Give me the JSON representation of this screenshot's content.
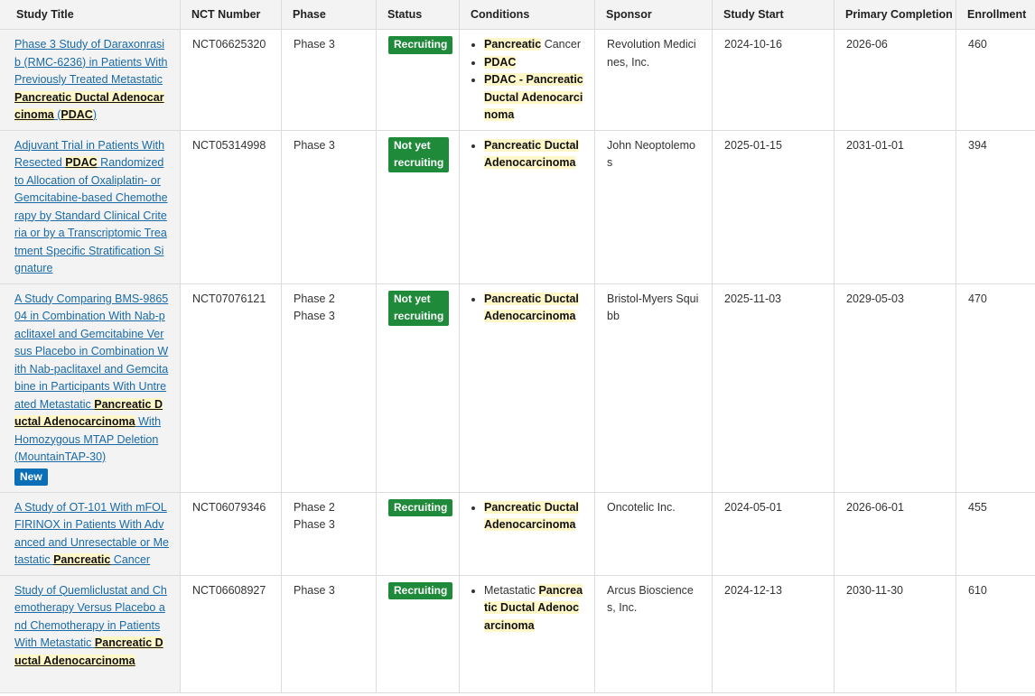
{
  "headers": {
    "title": "Study Title",
    "nct": "NCT Number",
    "phase": "Phase",
    "status": "Status",
    "conditions": "Conditions",
    "sponsor": "Sponsor",
    "start": "Study Start",
    "completion": "Primary Completion",
    "enrollment": "Enrollment"
  },
  "rows": [
    {
      "title": [
        {
          "t": "Phase 3 Study of Daraxonrasib (RMC-6236) in Patients With Previously Treated Metastatic "
        },
        {
          "t": "Pancreatic Ductal Adenocarcinoma",
          "hl": true
        },
        {
          "t": " ("
        },
        {
          "t": "PDAC",
          "hl": true
        },
        {
          "t": ")"
        }
      ],
      "new": "",
      "nct": "NCT06625320",
      "phases": [
        "Phase 3"
      ],
      "status": "Recruiting",
      "status_lines": [
        "Recruiting"
      ],
      "conditions": [
        [
          {
            "t": "Pancreatic",
            "hl": true
          },
          {
            "t": " Cancer"
          }
        ],
        [
          {
            "t": "PDAC",
            "hl": true
          }
        ],
        [
          {
            "t": "PDAC - Pancreatic Ductal Adenocarcinoma",
            "hl": true
          }
        ]
      ],
      "sponsor": "Revolution Medicines, Inc.",
      "start": "2024-10-16",
      "completion": "2026-06",
      "enrollment": "460"
    },
    {
      "title": [
        {
          "t": "Adjuvant Trial in Patients With Resected "
        },
        {
          "t": "PDAC",
          "hl": true
        },
        {
          "t": " Randomized to Allocation of Oxaliplatin- or Gemcitabine-based Chemotherapy by Standard Clinical Criteria or by a Transcriptomic Treatment Specific Stratification Signature"
        }
      ],
      "new": "",
      "nct": "NCT05314998",
      "phases": [
        "Phase 3"
      ],
      "status": "Not yet recruiting",
      "status_lines": [
        "Not yet",
        "recruiting"
      ],
      "conditions": [
        [
          {
            "t": "Pancreatic Ductal Adenocarcinoma",
            "hl": true
          }
        ]
      ],
      "sponsor": "John Neoptolemos",
      "start": "2025-01-15",
      "completion": "2031-01-01",
      "enrollment": "394"
    },
    {
      "title": [
        {
          "t": "A Study Comparing BMS-986504 in Combination With Nab-paclitaxel and Gemcitabine Versus Placebo in Combination With Nab-paclitaxel and Gemcitabine in Participants With Untreated Metastatic "
        },
        {
          "t": "Pancreatic Ductal Adenocarcinoma",
          "hl": true
        },
        {
          "t": " With Homozygous MTAP Deletion (MountainTAP-30)"
        }
      ],
      "new": "New",
      "nct": "NCT07076121",
      "phases": [
        "Phase 2",
        "Phase 3"
      ],
      "status": "Not yet recruiting",
      "status_lines": [
        "Not yet",
        "recruiting"
      ],
      "conditions": [
        [
          {
            "t": "Pancreatic Ductal Adenocarcinoma",
            "hl": true
          }
        ]
      ],
      "sponsor": "Bristol-Myers Squibb",
      "start": "2025-11-03",
      "completion": "2029-05-03",
      "enrollment": "470"
    },
    {
      "title": [
        {
          "t": "A Study of OT-101 With mFOLFIRINOX in Patients With Advanced and Unresectable or Metastatic "
        },
        {
          "t": "Pancreatic",
          "hl": true
        },
        {
          "t": " Cancer"
        }
      ],
      "new": "",
      "nct": "NCT06079346",
      "phases": [
        "Phase 2",
        "Phase 3"
      ],
      "status": "Recruiting",
      "status_lines": [
        "Recruiting"
      ],
      "conditions": [
        [
          {
            "t": "Pancreatic Ductal Adenocarcinoma",
            "hl": true
          }
        ]
      ],
      "sponsor": "Oncotelic Inc.",
      "start": "2024-05-01",
      "completion": "2026-06-01",
      "enrollment": "455"
    },
    {
      "title": [
        {
          "t": "Study of Quemliclustat and Chemotherapy Versus Placebo and Chemotherapy in Patients With Metastatic "
        },
        {
          "t": "Pancreatic Ductal Adenocarcinoma",
          "hl": true
        }
      ],
      "new": "",
      "nct": "NCT06608927",
      "phases": [
        "Phase 3"
      ],
      "status": "Recruiting",
      "status_lines": [
        "Recruiting"
      ],
      "conditions": [
        [
          {
            "t": "Metastatic "
          },
          {
            "t": "Pancreatic Ductal Adenocarcinoma",
            "hl": true
          }
        ]
      ],
      "sponsor": "Arcus Biosciences, Inc.",
      "start": "2024-12-13",
      "completion": "2030-11-30",
      "enrollment": "610"
    }
  ]
}
